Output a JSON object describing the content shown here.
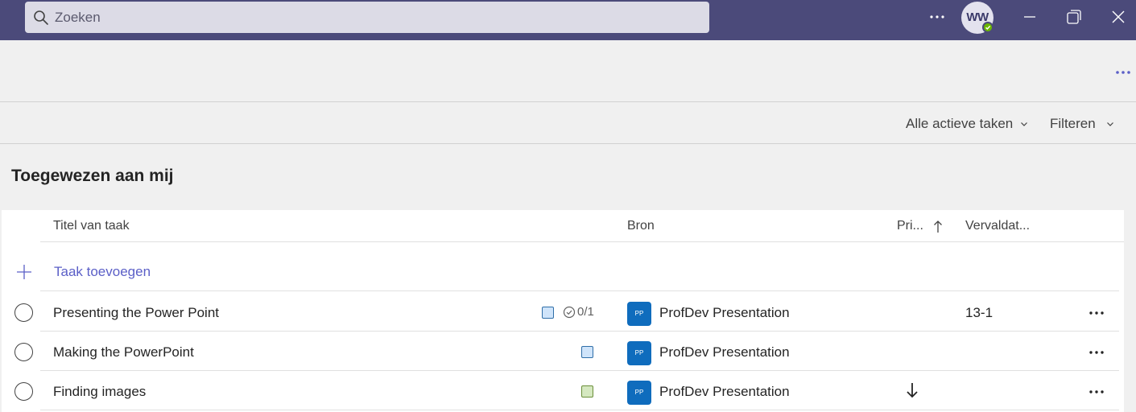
{
  "search": {
    "placeholder": "Zoeken"
  },
  "user": {
    "initials": "WW"
  },
  "toolbar": {
    "view_label": "Alle actieve taken",
    "filter_label": "Filteren"
  },
  "section": {
    "title": "Toegewezen aan mij"
  },
  "table": {
    "columns": {
      "title": "Titel van taak",
      "source": "Bron",
      "priority": "Pri...",
      "due": "Vervaldat..."
    },
    "add_label": "Taak toevoegen",
    "rows": [
      {
        "title": "Presenting the Power Point",
        "label_color": "#cfe4fa",
        "checklist": "0/1",
        "plan_icon_text": "PP",
        "source": "ProfDev Presentation",
        "priority_icon": "arrow-down-icon",
        "due": "13-1"
      },
      {
        "title": "Making the PowerPoint",
        "label_color": "#cfe4fa",
        "plan_icon_text": "PP",
        "source": "ProfDev Presentation",
        "due": ""
      },
      {
        "title": "Finding images",
        "label_color": "#d5e8c0",
        "plan_icon_text": "PP",
        "source": "ProfDev Presentation",
        "priority_icon": "arrow-down-icon",
        "due": ""
      }
    ]
  },
  "colors": {
    "titlebar": "#4b4a7a",
    "accent": "#5b5fc7",
    "plan_icon": "#0f6cbd",
    "presence": "#6bb700"
  }
}
